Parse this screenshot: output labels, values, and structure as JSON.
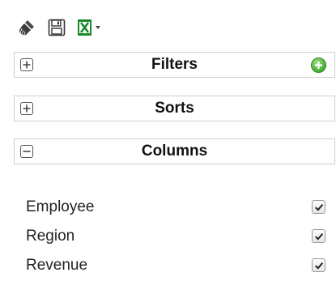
{
  "toolbar": {
    "icons": [
      "broom-icon",
      "save-icon",
      "excel-export-icon"
    ]
  },
  "panels": {
    "filters": {
      "title": "Filters",
      "expanded": false,
      "has_add": true
    },
    "sorts": {
      "title": "Sorts",
      "expanded": false
    },
    "columns": {
      "title": "Columns",
      "expanded": true
    }
  },
  "columns_list": [
    {
      "label": "Employee",
      "checked": true
    },
    {
      "label": "Region",
      "checked": true
    },
    {
      "label": "Revenue",
      "checked": true
    }
  ],
  "colors": {
    "add_button": "#3ea630",
    "excel_green": "#1a8a2a",
    "border": "#cfcfcf"
  }
}
